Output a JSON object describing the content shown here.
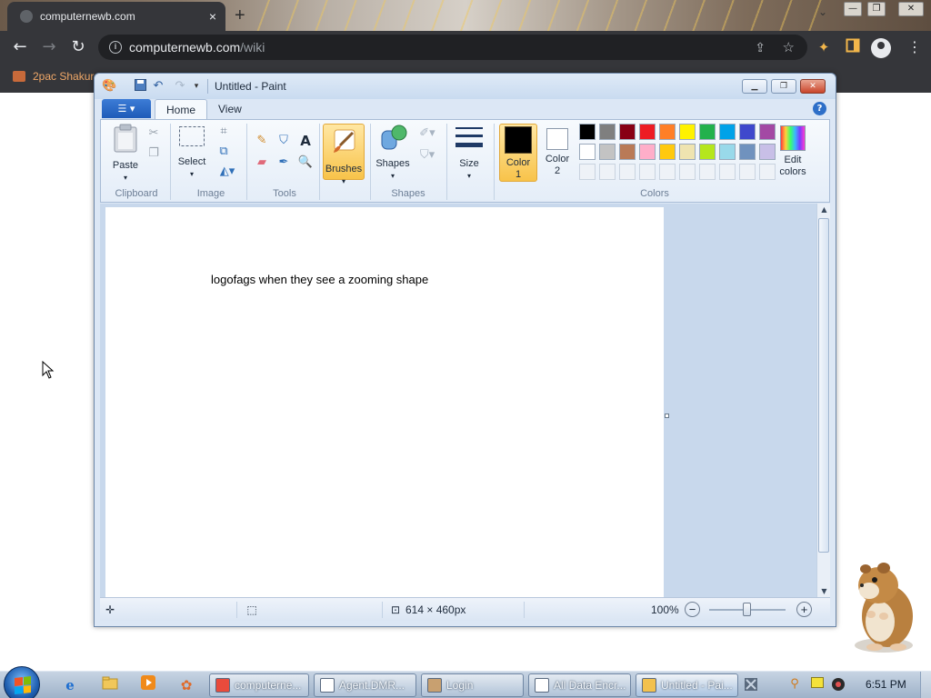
{
  "browser": {
    "tab_title": "computernewb.com",
    "new_tab_symbol": "+",
    "tab_close_symbol": "×",
    "url_host": "computernewb.com",
    "url_path": "/wiki",
    "bookmark_label": "2pac Shakur"
  },
  "paint": {
    "window_title": "Untitled - Paint",
    "tabs": [
      "Home",
      "View"
    ],
    "groups": {
      "clipboard": "Clipboard",
      "image": "Image",
      "tools": "Tools",
      "shapes": "Shapes",
      "colors": "Colors"
    },
    "buttons": {
      "paste": "Paste",
      "select": "Select",
      "brushes": "Brushes",
      "shapes": "Shapes",
      "size": "Size",
      "color1_line1": "Color",
      "color1_line2": "1",
      "color2_line1": "Color",
      "color2_line2": "2",
      "edit_colors_line1": "Edit",
      "edit_colors_line2": "colors"
    },
    "palette_row1": [
      "#000000",
      "#7f7f7f",
      "#880015",
      "#ed1c24",
      "#ff7f27",
      "#fff200",
      "#22b14c",
      "#00a2e8",
      "#3f48cc",
      "#a349a4"
    ],
    "palette_row2": [
      "#ffffff",
      "#c3c3c3",
      "#b97a57",
      "#ffaec9",
      "#ffc90e",
      "#efe4b0",
      "#b5e61d",
      "#99d9ea",
      "#7092be",
      "#c8bfe7"
    ],
    "color1": "#000000",
    "color2": "#ffffff",
    "canvas_text": "logofags when they see a zooming shape",
    "status": {
      "canvas_size": "614 × 460px",
      "zoom": "100%"
    }
  },
  "taskbar": {
    "tasks": [
      {
        "label": "computerne...",
        "icon_color": "#e94b3c"
      },
      {
        "label": "Agent.DMR...",
        "icon_color": "#ffffff"
      },
      {
        "label": "Login",
        "icon_color": "#c8a070"
      },
      {
        "label": "All Data Encr...",
        "icon_color": "#ffffff"
      },
      {
        "label": "Untitled - Pai...",
        "icon_color": "#f2c14e"
      }
    ],
    "clock": "6:51 PM"
  }
}
